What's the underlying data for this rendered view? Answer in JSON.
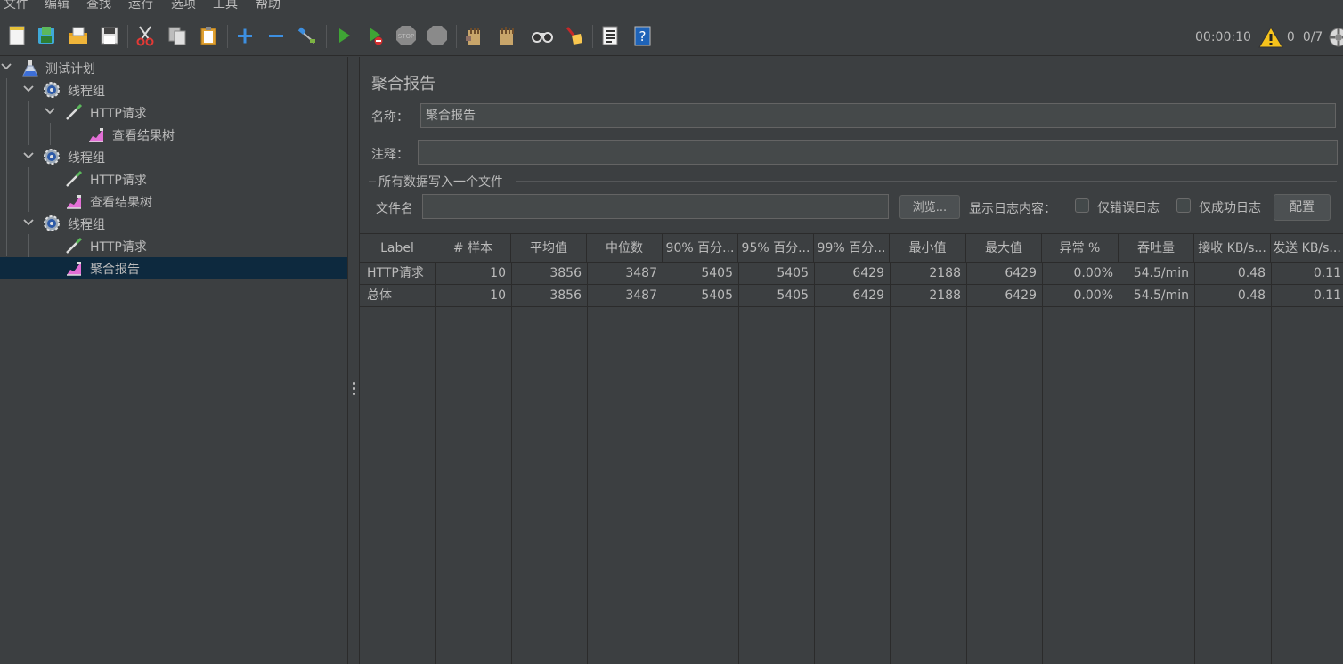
{
  "menu": [
    "文件",
    "编辑",
    "查找",
    "运行",
    "选项",
    "工具",
    "帮助"
  ],
  "toolbar": {
    "icons": [
      "new-icon",
      "templates-icon",
      "open-icon",
      "save-icon",
      "cut-icon",
      "copy-icon",
      "paste-icon",
      "expand-icon",
      "collapse-icon",
      "toggle-icon",
      "start-icon",
      "start-no-pause-icon",
      "stop-icon",
      "shutdown-icon",
      "clear-icon",
      "clear-all-icon",
      "search-icon",
      "reset-search-icon",
      "function-helper-icon",
      "help-icon"
    ],
    "timer": "00:00:10",
    "warning_count": "0",
    "threads": "0/7"
  },
  "tree": {
    "items": [
      {
        "label": "测试计划",
        "icon": "test-plan-icon"
      },
      {
        "label": "线程组",
        "icon": "gear-icon"
      },
      {
        "label": "HTTP请求",
        "icon": "pipette-icon"
      },
      {
        "label": "查看结果树",
        "icon": "chart-icon"
      },
      {
        "label": "线程组",
        "icon": "gear-icon"
      },
      {
        "label": "HTTP请求",
        "icon": "pipette-icon"
      },
      {
        "label": "查看结果树",
        "icon": "chart-icon"
      },
      {
        "label": "线程组",
        "icon": "gear-icon"
      },
      {
        "label": "HTTP请求",
        "icon": "pipette-icon"
      },
      {
        "label": "聚合报告",
        "icon": "chart-icon"
      }
    ]
  },
  "panel": {
    "title": "聚合报告",
    "name_label": "名称：",
    "name_value": "聚合报告",
    "comment_label": "注释：",
    "comment_value": "",
    "group_title": "所有数据写入一个文件",
    "filename_label": "文件名",
    "filename_value": "",
    "browse_button": "浏览...",
    "log_label": "显示日志内容：",
    "errors_only": "仅错误日志",
    "success_only": "仅成功日志",
    "config_button": "配置"
  },
  "table": {
    "headers": [
      "Label",
      "# 样本",
      "平均值",
      "中位数",
      "90% 百分...",
      "95% 百分...",
      "99% 百分...",
      "最小值",
      "最大值",
      "异常 %",
      "吞吐量",
      "接收 KB/s...",
      "发送 KB/s..."
    ],
    "rows": [
      [
        "HTTP请求",
        "10",
        "3856",
        "3487",
        "5405",
        "5405",
        "6429",
        "2188",
        "6429",
        "0.00%",
        "54.5/min",
        "0.48",
        "0.11"
      ],
      [
        "总体",
        "10",
        "3856",
        "3487",
        "5405",
        "5405",
        "6429",
        "2188",
        "6429",
        "0.00%",
        "54.5/min",
        "0.48",
        "0.11"
      ]
    ]
  },
  "colors": {
    "background": "#3c3f41",
    "selection": "#0d293e",
    "text": "#bbbbbb",
    "run_green": "#3fa535",
    "add_blue": "#3d8fe0"
  }
}
